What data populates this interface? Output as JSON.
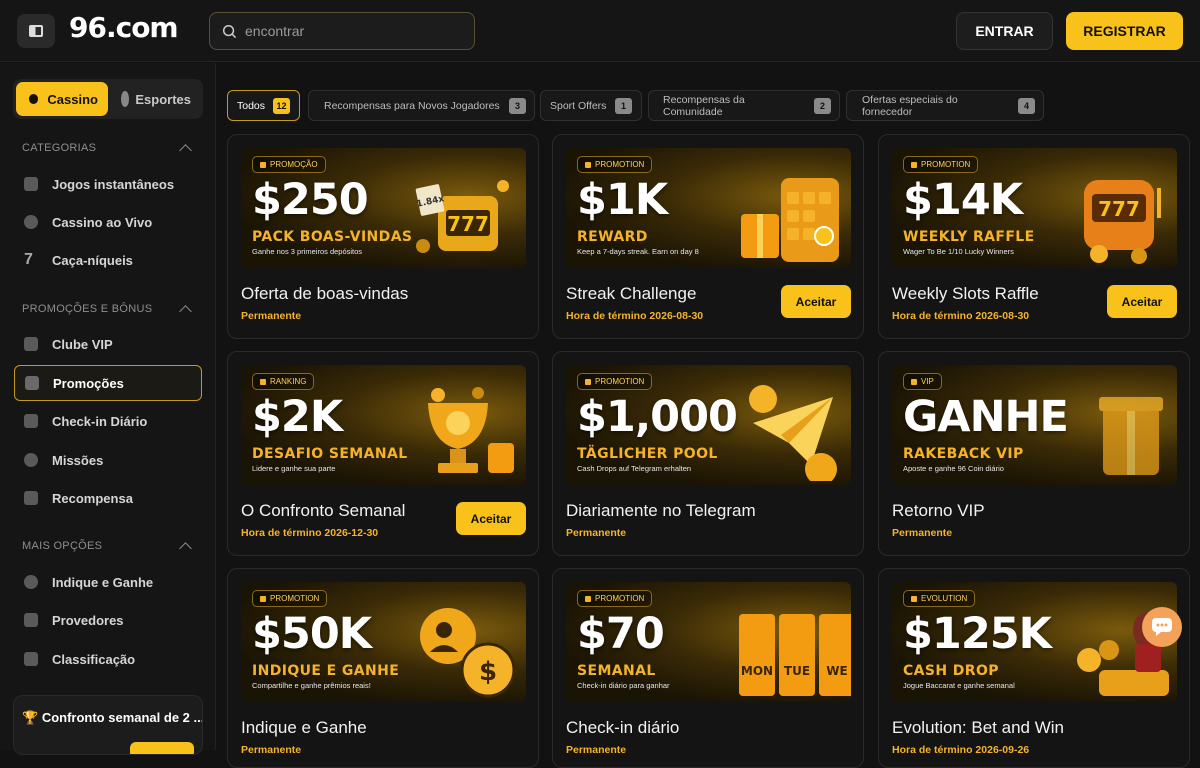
{
  "header": {
    "logo": "96.com",
    "search_placeholder": "encontrar",
    "login_label": "ENTRAR",
    "register_label": "REGISTRAR"
  },
  "sidebar": {
    "tabs": [
      {
        "label": "Cassino",
        "active": true
      },
      {
        "label": "Esportes",
        "active": false
      }
    ],
    "sections": [
      {
        "title": "CATEGORIAS",
        "items": [
          "Jogos instantâneos",
          "Cassino ao Vivo",
          "Caça-níqueis"
        ]
      },
      {
        "title": "PROMOÇÕES E BÔNUS",
        "items": [
          "Clube VIP",
          "Promoções",
          "Check-in Diário",
          "Missões",
          "Recompensa"
        ]
      },
      {
        "title": "MAIS OPÇÕES",
        "items": [
          "Indique e Ganhe",
          "Provedores",
          "Classificação"
        ]
      }
    ],
    "active_item": "Promoções",
    "weekly_card_title": "Confronto semanal de 2 ..."
  },
  "filters": [
    {
      "label": "Todos",
      "count": "12",
      "active": true
    },
    {
      "label": "Recompensas para Novos Jogadores",
      "count": "3",
      "active": false
    },
    {
      "label": "Sport Offers",
      "count": "1",
      "active": false
    },
    {
      "label": "Recompensas da Comunidade",
      "count": "2",
      "active": false
    },
    {
      "label": "Ofertas especiais do fornecedor",
      "count": "4",
      "active": false
    }
  ],
  "cards": [
    {
      "tag": "PROMOÇÃO",
      "amount": "$250",
      "sub": "PACK BOAS-VINDAS",
      "small": "Ganhe nos 3 primeiros depósitos",
      "title": "Oferta de boas-vindas",
      "meta": "Permanente",
      "button": ""
    },
    {
      "tag": "PROMOTION",
      "amount": "$1K",
      "sub": "REWARD",
      "small": "Keep a 7-days streak. Earn on day 8",
      "title": "Streak Challenge",
      "meta": "Hora de término 2026-08-30",
      "button": "Aceitar"
    },
    {
      "tag": "PROMOTION",
      "amount": "$14K",
      "sub": "WEEKLY RAFFLE",
      "small": "Wager To Be 1/10 Lucky Winners",
      "title": "Weekly Slots Raffle",
      "meta": "Hora de término 2026-08-30",
      "button": "Aceitar"
    },
    {
      "tag": "RANKING",
      "amount": "$2K",
      "sub": "DESAFIO SEMANAL",
      "small": "Lidere e ganhe sua parte",
      "title": "O Confronto Semanal",
      "meta": "Hora de término 2026-12-30",
      "button": "Aceitar"
    },
    {
      "tag": "PROMOTION",
      "amount": "$1,000",
      "sub": "TÄGLICHER POOL",
      "small": "Cash Drops auf Telegram erhalten",
      "title": "Diariamente no Telegram",
      "meta": "Permanente",
      "button": ""
    },
    {
      "tag": "VIP",
      "amount": "GANHE",
      "sub": "RAKEBACK VIP",
      "small": "Aposte e ganhe 96 Coin diário",
      "title": "Retorno VIP",
      "meta": "Permanente",
      "button": ""
    },
    {
      "tag": "PROMOTION",
      "amount": "$50K",
      "sub": "INDIQUE E GANHE",
      "small": "Compartilhe e ganhe prêmios reais!",
      "title": "Indique e Ganhe",
      "meta": "Permanente",
      "button": ""
    },
    {
      "tag": "PROMOTION",
      "amount": "$70",
      "sub": "SEMANAL",
      "small": "Check-in diário para ganhar",
      "title": "Check-in diário",
      "meta": "Permanente",
      "button": ""
    },
    {
      "tag": "EVOLUTION",
      "amount": "$125K",
      "sub": "CASH DROP",
      "small": "Jogue Baccarat e ganhe semanal",
      "title": "Evolution: Bet and Win",
      "meta": "Hora de término 2026-09-26",
      "button": ""
    }
  ],
  "banner_art_labels": {
    "slot_reels": "777",
    "multiplier": "1.84x",
    "days": [
      "MON",
      "TUE",
      "WE"
    ]
  },
  "colors": {
    "accent": "#f9c21b",
    "background": "#121212",
    "panel": "#151515",
    "meta": "#f5b32a"
  }
}
